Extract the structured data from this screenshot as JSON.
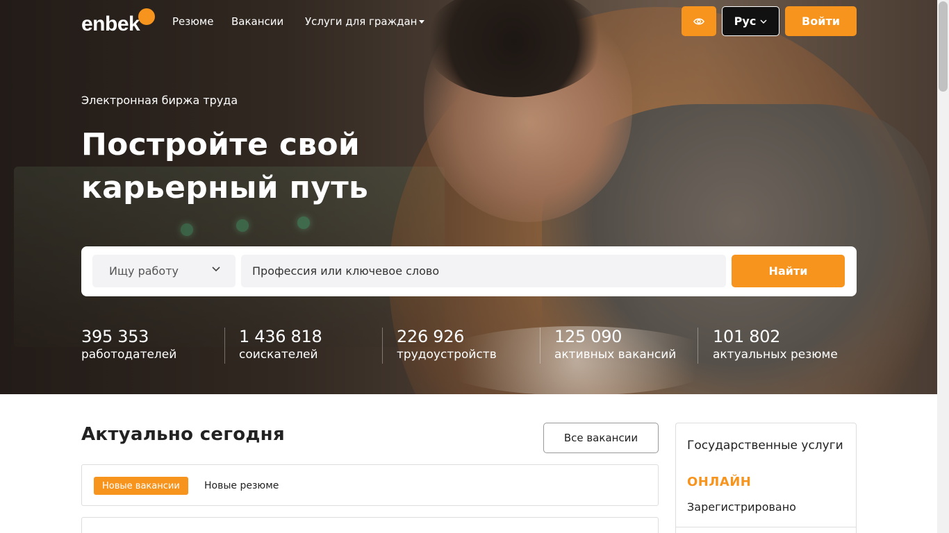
{
  "nav": {
    "logo": "enbek",
    "links": [
      "Резюме",
      "Вакансии",
      "Услуги для граждан"
    ],
    "language": "Рус",
    "login": "Войти"
  },
  "hero": {
    "subtitle": "Электронная биржа труда",
    "headline": "Постройте свой карьерный путь"
  },
  "search": {
    "mode": "Ищу работу",
    "placeholder": "Профессия или ключевое слово",
    "button": "Найти"
  },
  "stats": [
    {
      "value": "395 353",
      "label": "работодателей"
    },
    {
      "value": "1 436 818",
      "label": "соискателей"
    },
    {
      "value": "226 926",
      "label": "трудоустройств"
    },
    {
      "value": "125 090",
      "label": "активных вакансий"
    },
    {
      "value": "101 802",
      "label": "актуальных резюме"
    }
  ],
  "today": {
    "title": "Актуально сегодня",
    "all_button": "Все вакансии",
    "tabs": [
      "Новые вакансии",
      "Новые резюме"
    ]
  },
  "gov": {
    "title": "Государственные услуги",
    "online": "ОНЛАЙН",
    "registered": "Зарегистрировано"
  },
  "colors": {
    "accent": "#f7941d"
  },
  "icons": [
    "eye-icon",
    "chevron-down-icon"
  ]
}
